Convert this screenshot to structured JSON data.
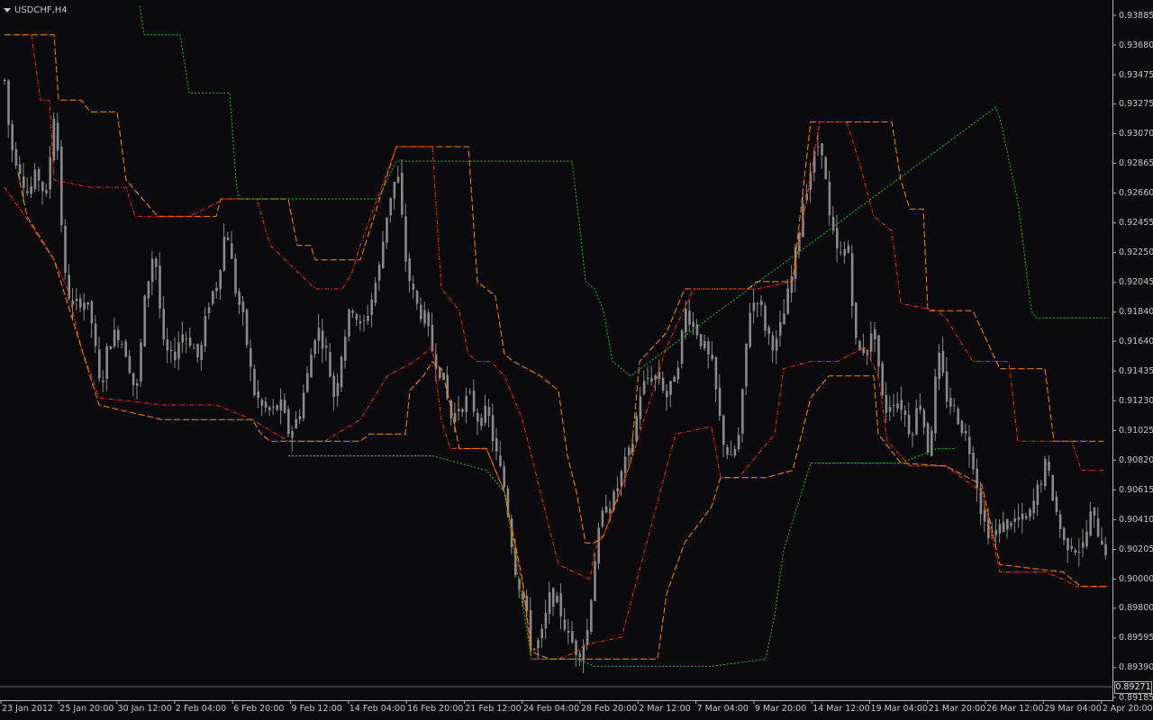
{
  "chart": {
    "symbol_label": "USDCHF,H4",
    "current_price": "0.89271",
    "price_labels": [
      "0.93885",
      "0.93680",
      "0.93475",
      "0.93275",
      "0.93070",
      "0.92865",
      "0.92660",
      "0.92455",
      "0.92250",
      "0.92045",
      "0.91840",
      "0.91640",
      "0.91435",
      "0.91230",
      "0.91025",
      "0.90820",
      "0.90615",
      "0.90410",
      "0.90205",
      "0.90000",
      "0.89800",
      "0.89595",
      "0.89390",
      "0.89185"
    ],
    "date_labels": [
      "23 Jan 2012",
      "25 Jan 20:00",
      "30 Jan 12:00",
      "2 Feb 04:00",
      "6 Feb 20:00",
      "9 Feb 12:00",
      "14 Feb 04:00",
      "16 Feb 20:00",
      "21 Feb 12:00",
      "24 Feb 04:00",
      "28 Feb 20:00",
      "2 Mar 12:00",
      "7 Mar 04:00",
      "9 Mar 20:00",
      "14 Mar 12:00",
      "19 Mar 04:00",
      "21 Mar 20:00",
      "26 Mar 12:00",
      "29 Mar 04:00",
      "2 Apr 20:00"
    ],
    "colors": {
      "background": "#0a0a0f",
      "axis": "#b4b4b4",
      "candle": "#8a8a8a",
      "channel_orange": "#ff8c00",
      "channel_red": "#ff2a00",
      "channel_green": "#22c022"
    }
  },
  "chart_data": {
    "type": "candlestick",
    "symbol": "USDCHF",
    "timeframe": "H4",
    "ylim": [
      0.89185,
      0.93885
    ],
    "close_path": [
      [
        0,
        0.9372
      ],
      [
        10,
        0.93
      ],
      [
        20,
        0.9285
      ],
      [
        30,
        0.9265
      ],
      [
        40,
        0.928
      ],
      [
        50,
        0.9262
      ],
      [
        60,
        0.933
      ],
      [
        70,
        0.921
      ],
      [
        80,
        0.9185
      ],
      [
        90,
        0.9195
      ],
      [
        100,
        0.918
      ],
      [
        110,
        0.913
      ],
      [
        120,
        0.9165
      ],
      [
        130,
        0.917
      ],
      [
        140,
        0.9155
      ],
      [
        150,
        0.9125
      ],
      [
        160,
        0.9195
      ],
      [
        170,
        0.923
      ],
      [
        180,
        0.916
      ],
      [
        190,
        0.915
      ],
      [
        200,
        0.917
      ],
      [
        210,
        0.9165
      ],
      [
        220,
        0.915
      ],
      [
        230,
        0.919
      ],
      [
        240,
        0.9205
      ],
      [
        250,
        0.9245
      ],
      [
        260,
        0.92
      ],
      [
        270,
        0.9175
      ],
      [
        280,
        0.913
      ],
      [
        290,
        0.9118
      ],
      [
        300,
        0.9115
      ],
      [
        310,
        0.912
      ],
      [
        320,
        0.91
      ],
      [
        330,
        0.9112
      ],
      [
        340,
        0.914
      ],
      [
        350,
        0.9175
      ],
      [
        360,
        0.916
      ],
      [
        370,
        0.9125
      ],
      [
        380,
        0.9165
      ],
      [
        390,
        0.919
      ],
      [
        400,
        0.917
      ],
      [
        410,
        0.919
      ],
      [
        420,
        0.9215
      ],
      [
        430,
        0.926
      ],
      [
        440,
        0.928
      ],
      [
        450,
        0.9215
      ],
      [
        460,
        0.919
      ],
      [
        470,
        0.918
      ],
      [
        480,
        0.9155
      ],
      [
        490,
        0.914
      ],
      [
        500,
        0.911
      ],
      [
        510,
        0.912
      ],
      [
        520,
        0.9125
      ],
      [
        530,
        0.911
      ],
      [
        540,
        0.9115
      ],
      [
        550,
        0.9085
      ],
      [
        560,
        0.906
      ],
      [
        570,
        0.901
      ],
      [
        580,
        0.8985
      ],
      [
        590,
        0.895
      ],
      [
        600,
        0.896
      ],
      [
        610,
        0.899
      ],
      [
        620,
        0.898
      ],
      [
        630,
        0.896
      ],
      [
        640,
        0.895
      ],
      [
        650,
        0.896
      ],
      [
        660,
        0.902
      ],
      [
        670,
        0.905
      ],
      [
        680,
        0.9055
      ],
      [
        690,
        0.9075
      ],
      [
        700,
        0.909
      ],
      [
        710,
        0.913
      ],
      [
        720,
        0.914
      ],
      [
        730,
        0.914
      ],
      [
        740,
        0.9125
      ],
      [
        750,
        0.9145
      ],
      [
        760,
        0.9185
      ],
      [
        770,
        0.9175
      ],
      [
        780,
        0.916
      ],
      [
        790,
        0.9145
      ],
      [
        800,
        0.91
      ],
      [
        810,
        0.908
      ],
      [
        820,
        0.91
      ],
      [
        830,
        0.9185
      ],
      [
        840,
        0.9195
      ],
      [
        850,
        0.917
      ],
      [
        860,
        0.916
      ],
      [
        870,
        0.9185
      ],
      [
        880,
        0.9215
      ],
      [
        890,
        0.926
      ],
      [
        900,
        0.9285
      ],
      [
        910,
        0.9305
      ],
      [
        920,
        0.9245
      ],
      [
        930,
        0.922
      ],
      [
        940,
        0.923
      ],
      [
        950,
        0.9155
      ],
      [
        960,
        0.916
      ],
      [
        970,
        0.917
      ],
      [
        980,
        0.9115
      ],
      [
        990,
        0.9125
      ],
      [
        1000,
        0.912
      ],
      [
        1010,
        0.91
      ],
      [
        1020,
        0.9125
      ],
      [
        1030,
        0.9085
      ],
      [
        1040,
        0.9155
      ],
      [
        1050,
        0.9125
      ],
      [
        1060,
        0.9115
      ],
      [
        1070,
        0.91
      ],
      [
        1080,
        0.908
      ],
      [
        1090,
        0.904
      ],
      [
        1100,
        0.903
      ],
      [
        1110,
        0.9035
      ],
      [
        1120,
        0.904
      ],
      [
        1130,
        0.904
      ],
      [
        1140,
        0.904
      ],
      [
        1150,
        0.906
      ],
      [
        1160,
        0.908
      ],
      [
        1170,
        0.905
      ],
      [
        1180,
        0.9025
      ],
      [
        1190,
        0.9025
      ],
      [
        1200,
        0.902
      ],
      [
        1210,
        0.9045
      ],
      [
        1220,
        0.903
      ],
      [
        1230,
        0.9015
      ]
    ],
    "channels": {
      "orange_upper": [
        [
          5,
          0.9375
        ],
        [
          60,
          0.9375
        ],
        [
          65,
          0.933
        ],
        [
          90,
          0.933
        ],
        [
          100,
          0.9322
        ],
        [
          130,
          0.9322
        ],
        [
          140,
          0.9275
        ],
        [
          175,
          0.925
        ],
        [
          200,
          0.925
        ],
        [
          210,
          0.925
        ],
        [
          240,
          0.925
        ],
        [
          245,
          0.9262
        ],
        [
          290,
          0.9262
        ],
        [
          300,
          0.9262
        ],
        [
          320,
          0.9262
        ],
        [
          330,
          0.923
        ],
        [
          345,
          0.923
        ],
        [
          350,
          0.922
        ],
        [
          400,
          0.922
        ],
        [
          440,
          0.9298
        ],
        [
          500,
          0.9298
        ],
        [
          520,
          0.9298
        ],
        [
          530,
          0.9205
        ],
        [
          550,
          0.9195
        ],
        [
          560,
          0.9155
        ],
        [
          570,
          0.915
        ],
        [
          585,
          0.9145
        ],
        [
          600,
          0.914
        ],
        [
          620,
          0.913
        ],
        [
          630,
          0.9085
        ],
        [
          640,
          0.906
        ],
        [
          650,
          0.9025
        ],
        [
          660,
          0.9025
        ],
        [
          670,
          0.903
        ],
        [
          700,
          0.908
        ],
        [
          710,
          0.915
        ],
        [
          740,
          0.917
        ],
        [
          760,
          0.92
        ],
        [
          800,
          0.92
        ],
        [
          830,
          0.92
        ],
        [
          840,
          0.9205
        ],
        [
          880,
          0.9205
        ],
        [
          900,
          0.9315
        ],
        [
          990,
          0.9315
        ],
        [
          1000,
          0.9275
        ],
        [
          1010,
          0.9255
        ],
        [
          1025,
          0.9255
        ],
        [
          1030,
          0.9185
        ],
        [
          1080,
          0.9185
        ],
        [
          1110,
          0.9145
        ],
        [
          1160,
          0.9145
        ],
        [
          1170,
          0.9095
        ],
        [
          1225,
          0.9095
        ]
      ],
      "red_upper": [
        [
          35,
          0.9375
        ],
        [
          45,
          0.933
        ],
        [
          55,
          0.933
        ],
        [
          60,
          0.9275
        ],
        [
          100,
          0.927
        ],
        [
          140,
          0.927
        ],
        [
          150,
          0.925
        ],
        [
          210,
          0.925
        ],
        [
          250,
          0.9262
        ],
        [
          285,
          0.9262
        ],
        [
          300,
          0.923
        ],
        [
          350,
          0.92
        ],
        [
          380,
          0.92
        ],
        [
          390,
          0.921
        ],
        [
          400,
          0.923
        ],
        [
          440,
          0.9298
        ],
        [
          480,
          0.9298
        ],
        [
          490,
          0.92
        ],
        [
          510,
          0.9185
        ],
        [
          520,
          0.9155
        ],
        [
          530,
          0.915
        ],
        [
          545,
          0.915
        ],
        [
          560,
          0.914
        ],
        [
          580,
          0.911
        ],
        [
          600,
          0.906
        ],
        [
          620,
          0.901
        ],
        [
          655,
          0.9
        ],
        [
          660,
          0.902
        ],
        [
          670,
          0.903
        ],
        [
          700,
          0.908
        ],
        [
          740,
          0.916
        ],
        [
          770,
          0.92
        ],
        [
          800,
          0.92
        ],
        [
          830,
          0.92
        ],
        [
          840,
          0.92
        ],
        [
          880,
          0.9205
        ],
        [
          910,
          0.9315
        ],
        [
          940,
          0.9315
        ],
        [
          955,
          0.9285
        ],
        [
          970,
          0.925
        ],
        [
          990,
          0.924
        ],
        [
          1000,
          0.919
        ],
        [
          1040,
          0.9185
        ],
        [
          1050,
          0.918
        ],
        [
          1080,
          0.915
        ],
        [
          1120,
          0.915
        ],
        [
          1130,
          0.9095
        ],
        [
          1160,
          0.9095
        ],
        [
          1190,
          0.9095
        ],
        [
          1200,
          0.9075
        ],
        [
          1225,
          0.9075
        ]
      ],
      "red_lower": [
        [
          5,
          0.927
        ],
        [
          30,
          0.9248
        ],
        [
          60,
          0.922
        ],
        [
          75,
          0.92
        ],
        [
          90,
          0.916
        ],
        [
          110,
          0.9125
        ],
        [
          180,
          0.912
        ],
        [
          240,
          0.912
        ],
        [
          280,
          0.911
        ],
        [
          320,
          0.9095
        ],
        [
          360,
          0.9095
        ],
        [
          400,
          0.911
        ],
        [
          430,
          0.914
        ],
        [
          460,
          0.915
        ],
        [
          480,
          0.916
        ],
        [
          490,
          0.911
        ],
        [
          500,
          0.909
        ],
        [
          540,
          0.909
        ],
        [
          560,
          0.906
        ],
        [
          580,
          0.8995
        ],
        [
          590,
          0.8945
        ],
        [
          620,
          0.8945
        ],
        [
          640,
          0.895
        ],
        [
          650,
          0.8955
        ],
        [
          690,
          0.896
        ],
        [
          720,
          0.903
        ],
        [
          750,
          0.91
        ],
        [
          790,
          0.9105
        ],
        [
          800,
          0.907
        ],
        [
          820,
          0.907
        ],
        [
          860,
          0.91
        ],
        [
          870,
          0.9145
        ],
        [
          900,
          0.915
        ],
        [
          930,
          0.915
        ],
        [
          960,
          0.916
        ],
        [
          975,
          0.914
        ],
        [
          985,
          0.9095
        ],
        [
          1000,
          0.9085
        ],
        [
          1010,
          0.9078
        ],
        [
          1050,
          0.9078
        ],
        [
          1090,
          0.906
        ],
        [
          1110,
          0.9005
        ],
        [
          1160,
          0.9005
        ],
        [
          1180,
          0.9
        ],
        [
          1195,
          0.8995
        ],
        [
          1230,
          0.8995
        ]
      ],
      "orange_lower": [
        [
          20,
          0.928
        ],
        [
          30,
          0.925
        ],
        [
          60,
          0.922
        ],
        [
          110,
          0.912
        ],
        [
          180,
          0.911
        ],
        [
          280,
          0.911
        ],
        [
          290,
          0.91
        ],
        [
          300,
          0.9095
        ],
        [
          360,
          0.9095
        ],
        [
          400,
          0.9095
        ],
        [
          410,
          0.91
        ],
        [
          450,
          0.91
        ],
        [
          455,
          0.913
        ],
        [
          470,
          0.914
        ],
        [
          480,
          0.915
        ],
        [
          490,
          0.9145
        ],
        [
          500,
          0.912
        ],
        [
          510,
          0.909
        ],
        [
          540,
          0.909
        ],
        [
          560,
          0.906
        ],
        [
          580,
          0.9
        ],
        [
          590,
          0.895
        ],
        [
          610,
          0.8945
        ],
        [
          640,
          0.8945
        ],
        [
          660,
          0.8945
        ],
        [
          730,
          0.8945
        ],
        [
          740,
          0.899
        ],
        [
          760,
          0.9025
        ],
        [
          790,
          0.905
        ],
        [
          800,
          0.907
        ],
        [
          850,
          0.907
        ],
        [
          880,
          0.9075
        ],
        [
          900,
          0.9125
        ],
        [
          920,
          0.914
        ],
        [
          970,
          0.914
        ],
        [
          975,
          0.91
        ],
        [
          1000,
          0.908
        ],
        [
          1050,
          0.9078
        ],
        [
          1090,
          0.9065
        ],
        [
          1110,
          0.901
        ],
        [
          1180,
          0.9005
        ],
        [
          1200,
          0.8995
        ],
        [
          1230,
          0.8995
        ]
      ],
      "green_upper": [
        [
          155,
          0.9395
        ],
        [
          160,
          0.9375
        ],
        [
          200,
          0.9375
        ],
        [
          210,
          0.9335
        ],
        [
          255,
          0.9335
        ],
        [
          262,
          0.9275
        ],
        [
          265,
          0.9262
        ],
        [
          420,
          0.9262
        ],
        [
          440,
          0.9288
        ],
        [
          635,
          0.9288
        ],
        [
          645,
          0.9235
        ],
        [
          650,
          0.9205
        ],
        [
          660,
          0.92
        ],
        [
          670,
          0.9185
        ],
        [
          680,
          0.915
        ],
        [
          700,
          0.914
        ],
        [
          1105,
          0.9325
        ],
        [
          1110,
          0.9318
        ],
        [
          1130,
          0.926
        ],
        [
          1145,
          0.9185
        ],
        [
          1150,
          0.918
        ],
        [
          1230,
          0.918
        ]
      ],
      "green_lower": [
        [
          320,
          0.9085
        ],
        [
          480,
          0.9085
        ],
        [
          540,
          0.9075
        ],
        [
          560,
          0.906
        ],
        [
          590,
          0.8945
        ],
        [
          640,
          0.8945
        ],
        [
          660,
          0.894
        ],
        [
          790,
          0.894
        ],
        [
          850,
          0.8945
        ],
        [
          860,
          0.8975
        ],
        [
          870,
          0.902
        ],
        [
          885,
          0.905
        ],
        [
          900,
          0.908
        ],
        [
          1000,
          0.908
        ],
        [
          1020,
          0.9085
        ],
        [
          1040,
          0.909
        ],
        [
          1060,
          0.909
        ]
      ]
    }
  }
}
